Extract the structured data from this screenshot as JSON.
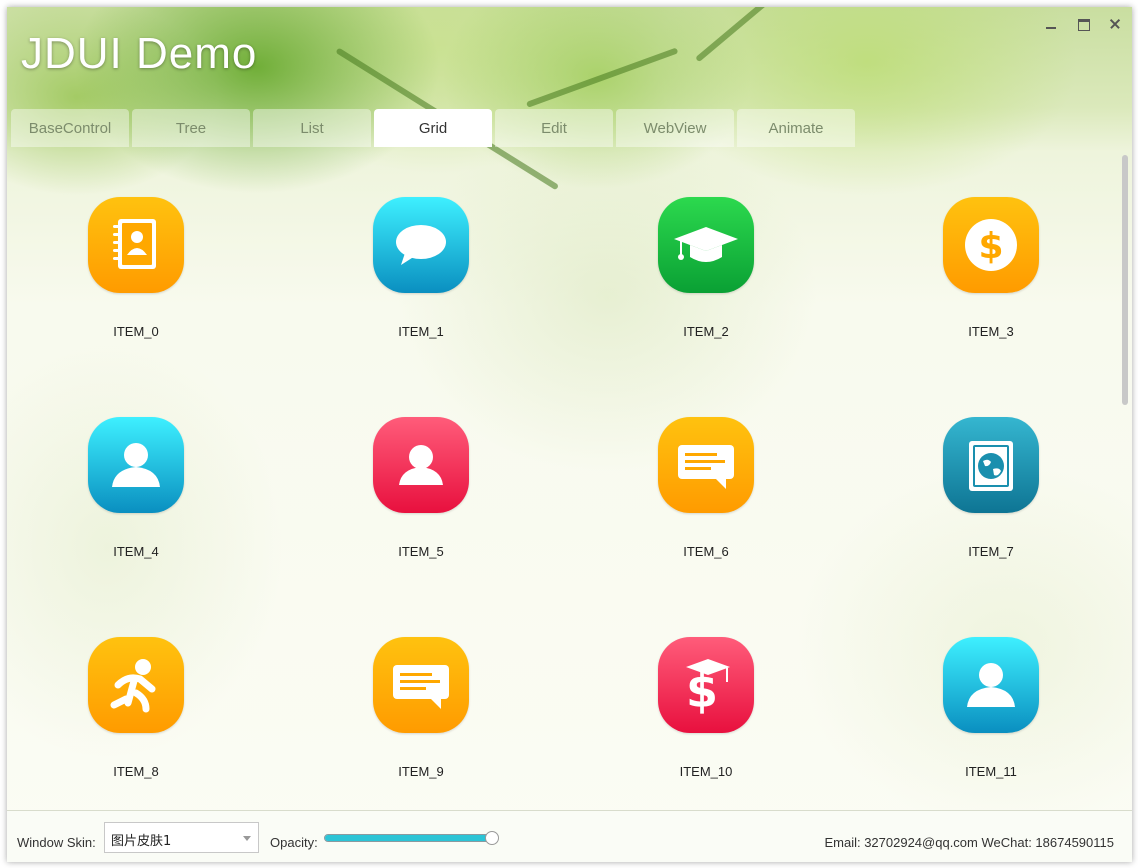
{
  "app": {
    "title": "JDUI Demo"
  },
  "window_controls": {
    "minimize": "minimize-icon",
    "maximize": "maximize-icon",
    "close": "close-icon"
  },
  "tabs": [
    {
      "label": "BaseControl",
      "active": false
    },
    {
      "label": "Tree",
      "active": false
    },
    {
      "label": "List",
      "active": false
    },
    {
      "label": "Grid",
      "active": true
    },
    {
      "label": "Edit",
      "active": false
    },
    {
      "label": "WebView",
      "active": false
    },
    {
      "label": "Animate",
      "active": false
    }
  ],
  "grid": {
    "items": [
      {
        "label": "ITEM_0",
        "icon": "contacts-book-icon",
        "color": "orange"
      },
      {
        "label": "ITEM_1",
        "icon": "chat-bubble-icon",
        "color": "cyan"
      },
      {
        "label": "ITEM_2",
        "icon": "graduation-cap-icon",
        "color": "green"
      },
      {
        "label": "ITEM_3",
        "icon": "dollar-coin-icon",
        "color": "orange"
      },
      {
        "label": "ITEM_4",
        "icon": "user-icon",
        "color": "cyan"
      },
      {
        "label": "ITEM_5",
        "icon": "user-icon",
        "color": "red"
      },
      {
        "label": "ITEM_6",
        "icon": "message-icon",
        "color": "orange"
      },
      {
        "label": "ITEM_7",
        "icon": "globe-book-icon",
        "color": "teal"
      },
      {
        "label": "ITEM_8",
        "icon": "running-man-icon",
        "color": "orange"
      },
      {
        "label": "ITEM_9",
        "icon": "message-icon",
        "color": "orange"
      },
      {
        "label": "ITEM_10",
        "icon": "dollar-graduation-icon",
        "color": "red"
      },
      {
        "label": "ITEM_11",
        "icon": "user-icon",
        "color": "cyan"
      }
    ]
  },
  "footer": {
    "skin_label": "Window Skin:",
    "skin_value": "图片皮肤1",
    "opacity_label": "Opacity:",
    "opacity_value": 1.0,
    "contact": "Email: 32702924@qq.com WeChat: 18674590115"
  },
  "colors": {
    "accent": "#2bc4d6",
    "orange": "#ffa800",
    "cyan": "#1ab6d8",
    "green": "#18bb3e",
    "red": "#f2305a",
    "teal": "#1a8fae"
  }
}
